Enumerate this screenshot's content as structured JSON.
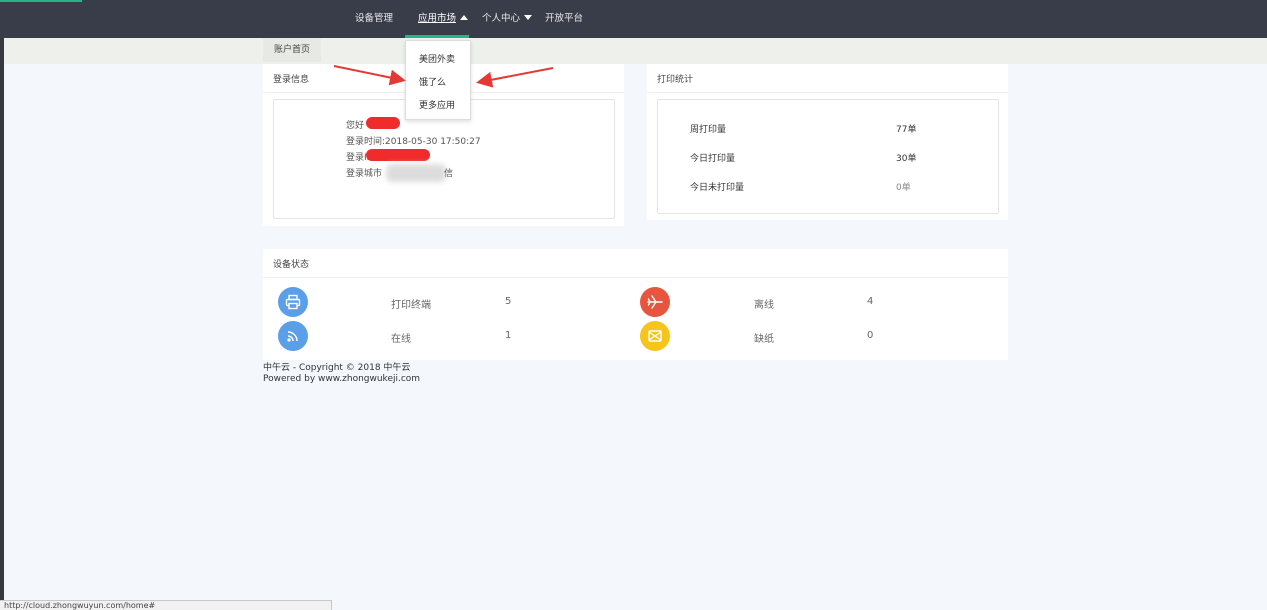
{
  "nav": {
    "items": [
      {
        "label": "设备管理"
      },
      {
        "label": "应用市场"
      },
      {
        "label": "个人中心"
      },
      {
        "label": "开放平台"
      }
    ]
  },
  "tabs": [
    {
      "label": "账户首页"
    }
  ],
  "dropdown": {
    "items": [
      {
        "label": "美团外卖"
      },
      {
        "label": "饿了么"
      },
      {
        "label": "更多应用"
      }
    ]
  },
  "login_info": {
    "title": "登录信息",
    "greeting": "您好",
    "login_time": "登录时间:2018-05-30 17:50:27",
    "login_ip": "登录IP",
    "login_city_prefix": "登录城市",
    "login_city_suffix": "信"
  },
  "print_stats": {
    "title": "打印统计",
    "rows": [
      {
        "label": "周打印量",
        "value": "77单"
      },
      {
        "label": "今日打印量",
        "value": "30单"
      },
      {
        "label": "今日未打印量",
        "value": "0单"
      }
    ]
  },
  "device_status": {
    "title": "设备状态",
    "items": [
      {
        "label": "打印终端",
        "value": "5",
        "icon": "printer-icon",
        "color": "#5b9fe8"
      },
      {
        "label": "离线",
        "value": "4",
        "icon": "airplane-icon",
        "color": "#e8553e"
      },
      {
        "label": "在线",
        "value": "1",
        "icon": "wifi-icon",
        "color": "#5b9fe8"
      },
      {
        "label": "缺纸",
        "value": "0",
        "icon": "paper-icon",
        "color": "#f5c51c"
      }
    ]
  },
  "footer": {
    "line1": "中午云 - Copyright © 2018 中午云",
    "line2": "Powered by www.zhongwukeji.com"
  },
  "status_url": "http://cloud.zhongwuyun.com/home#",
  "colors": {
    "topbar": "#393d49",
    "accent": "#2ab28a",
    "annotation_red": "#e53935"
  }
}
